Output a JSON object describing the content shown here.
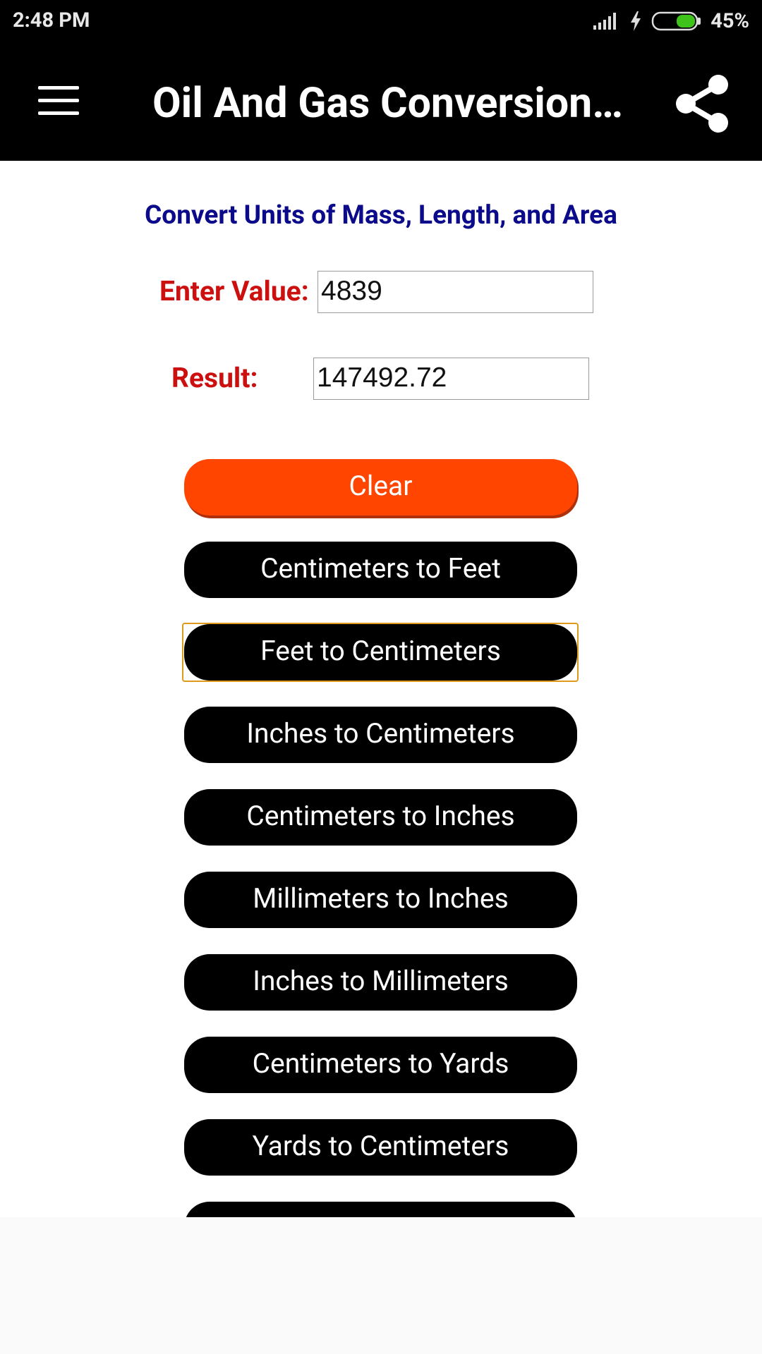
{
  "status_bar": {
    "time": "2:48 PM",
    "battery_percent": "45%",
    "battery_level": 0.45,
    "icons": [
      "signal-icon",
      "charging-icon",
      "battery-icon"
    ]
  },
  "app_bar": {
    "title": "Oil And Gas Conversion…",
    "icons": [
      "menu-icon",
      "share-icon"
    ]
  },
  "converter": {
    "heading": "Convert Units of Mass, Length, and Area",
    "enter_value_label": "Enter Value:",
    "enter_value": "4839",
    "result_label": "Result:",
    "result_value": "147492.72",
    "clear_button": "Clear",
    "buttons": [
      "Centimeters to Feet",
      "Feet to Centimeters",
      "Inches to Centimeters",
      "Centimeters to Inches",
      "Millimeters to Inches",
      "Inches to Millimeters",
      "Centimeters to Yards",
      "Yards to Centimeters"
    ],
    "focused_button_index": 1
  },
  "colors": {
    "app_bar": "#000000",
    "heading": "#0a0a8a",
    "label": "#cc1010",
    "clear_button": "#ff4500",
    "button": "#000000",
    "focus_ring": "#e09a1a"
  }
}
